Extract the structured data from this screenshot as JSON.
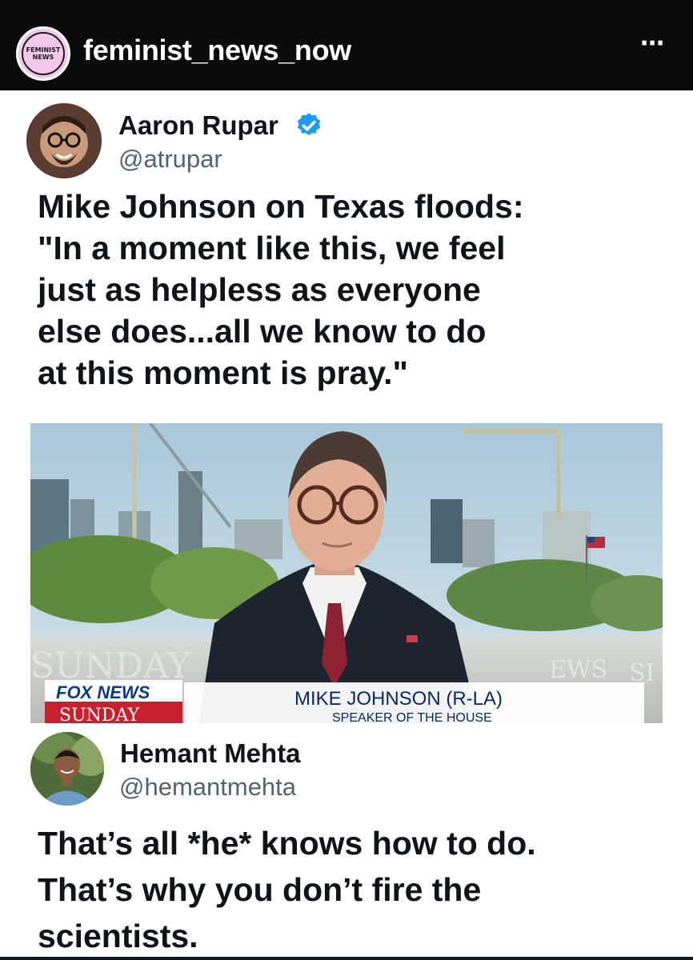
{
  "post_header": {
    "username": "feminist_news_now",
    "avatar_text_line1": "FEMINIST",
    "avatar_text_line2": "NEWS",
    "more_icon": "⋯"
  },
  "tweet1": {
    "name": "Aaron Rupar",
    "handle": "@atrupar",
    "verified": true,
    "text_lines": [
      "Mike Johnson on Texas floods:",
      "\"In a moment like this, we feel",
      "just as helpless as everyone",
      "else does...all we know to do",
      "at this moment is pray.\""
    ],
    "image": {
      "lower_third_name": "MIKE JOHNSON (R-LA)",
      "lower_third_title": "SPEAKER OF THE HOUSE",
      "network_logo": "FOX NEWS",
      "network_show": "SUNDAY",
      "backdrop_text": "SUNDAY",
      "backdrop_text_right": "EWS",
      "backdrop_text_right2": "SI"
    }
  },
  "tweet2": {
    "name": "Hemant Mehta",
    "handle": "@hemantmehta",
    "text_lines": [
      "That’s all *he* knows how to do.",
      "That’s why you don’t fire the",
      "scientists."
    ]
  },
  "colors": {
    "header_bg": "#0b0b0b",
    "avatar_ring": "#f4c8ea",
    "verified_blue": "#1d9bf0",
    "handle_gray": "#536471",
    "fox_red": "#c8202f",
    "fox_blue": "#0a3a8c"
  }
}
